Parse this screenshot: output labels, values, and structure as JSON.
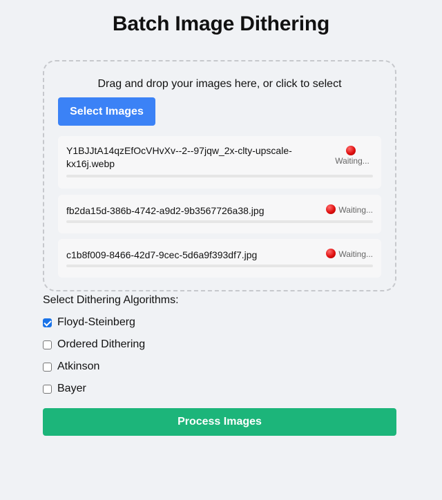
{
  "page_title": "Batch Image Dithering",
  "dropzone": {
    "prompt": "Drag and drop your images here, or click to select",
    "select_button": "Select Images",
    "files": [
      {
        "name": "Y1BJJtA14qzEfOcVHvXv--2--97jqw_2x-clty-upscale-kx16j.webp",
        "status": "Waiting...",
        "progress": 0
      },
      {
        "name": "fb2da15d-386b-4742-a9d2-9b3567726a38.jpg",
        "status": "Waiting...",
        "progress": 0
      },
      {
        "name": "c1b8f009-8466-42d7-9cec-5d6a9f393df7.jpg",
        "status": "Waiting...",
        "progress": 0
      }
    ]
  },
  "algorithms": {
    "title": "Select Dithering Algorithms:",
    "options": [
      {
        "label": "Floyd-Steinberg",
        "checked": true
      },
      {
        "label": "Ordered Dithering",
        "checked": false
      },
      {
        "label": "Atkinson",
        "checked": false
      },
      {
        "label": "Bayer",
        "checked": false
      }
    ]
  },
  "process_button": "Process Images",
  "colors": {
    "background": "#f0f2f5",
    "select_button": "#3b82f6",
    "process_button": "#1cb57a",
    "status_dot": "#e01010"
  },
  "icons": {
    "status": "red-circle-icon"
  }
}
